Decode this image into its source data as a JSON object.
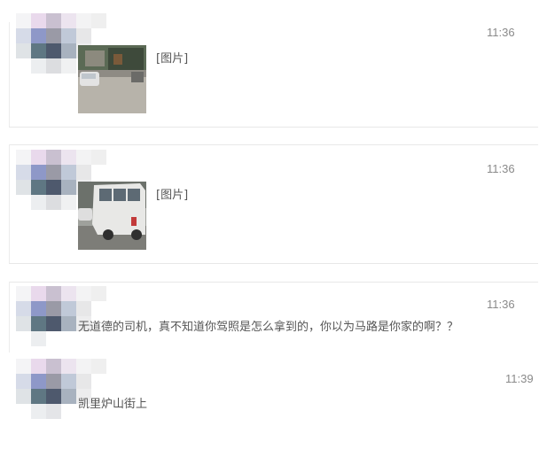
{
  "messages": [
    {
      "time": "11:36",
      "text": "[图片]",
      "has_image": true,
      "image_kind": "street-scene-thumbnail"
    },
    {
      "time": "11:36",
      "text": "[图片]",
      "has_image": true,
      "image_kind": "van-photo-thumbnail"
    },
    {
      "time": "11:36",
      "text": "无道德的司机，真不知道你驾照是怎么拿到的，你以为马路是你家的啊？？",
      "has_image": false
    },
    {
      "time": "11:39",
      "text": "凯里炉山街上",
      "has_image": false
    }
  ],
  "colors": {
    "background": "#ffffff",
    "divider": "#e8e8e8",
    "timestamp": "#8a8a8a",
    "message_text": "#555555"
  },
  "icons": [
    "pixelated-avatar",
    "photo-thumbnail"
  ]
}
